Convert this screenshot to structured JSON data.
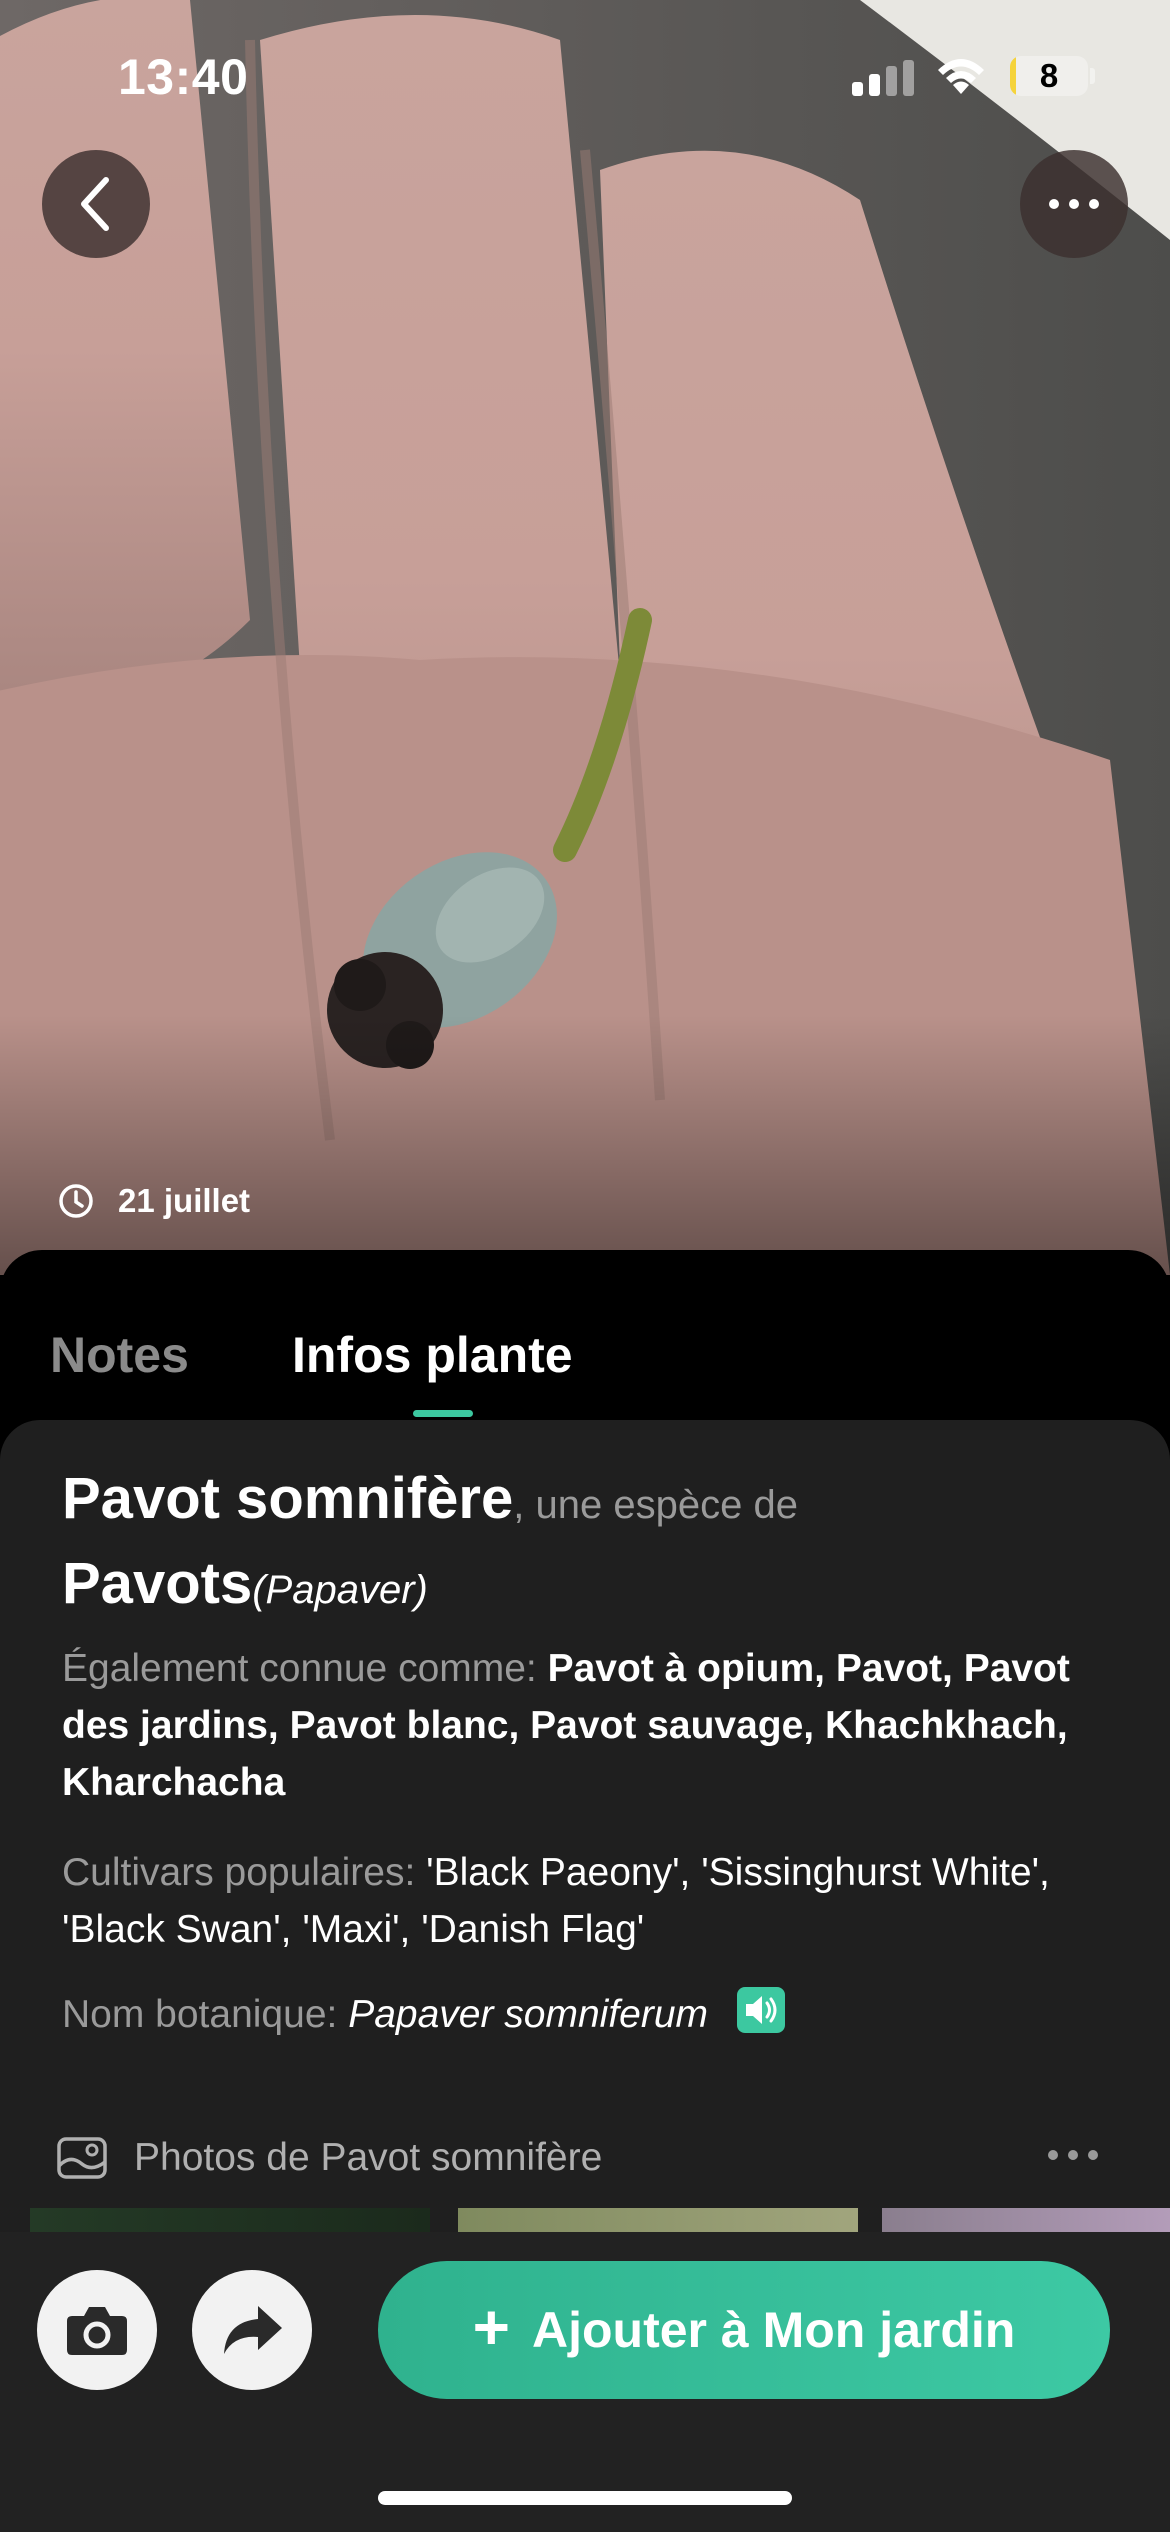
{
  "status_bar": {
    "time": "13:40",
    "battery_level": "8",
    "battery_fraction": 0.08
  },
  "photo": {
    "date": "21 juillet",
    "back_icon": "chevron-left-icon",
    "more_icon": "more-horizontal-icon",
    "clock_icon": "clock-icon"
  },
  "tabs": [
    {
      "label": "Notes",
      "active": false
    },
    {
      "label": "Infos plante",
      "active": true
    }
  ],
  "plant": {
    "common_name": "Pavot somnifère",
    "species_of": ", une espèce de",
    "genus": "Pavots",
    "genus_latin": "(Papaver)",
    "aka_label": "Également connue comme:",
    "aka_values": "Pavot à opium, Pavot, Pavot des jardins, Pavot blanc, Pavot sauvage, Khachkhach, Kharchacha",
    "cultivars_label": "Cultivars populaires:",
    "cultivars_values": "'Black Paeony', 'Sissinghurst White', 'Black Swan', 'Maxi', 'Danish Flag'",
    "botanical_label": "Nom botanique:",
    "botanical_value": "Papaver somniferum"
  },
  "photos_section": {
    "title": "Photos de Pavot somnifère",
    "icon": "photo-gallery-icon"
  },
  "bottom_bar": {
    "camera_icon": "camera-icon",
    "share_icon": "share-arrow-icon",
    "add_label": "Ajouter à Mon jardin"
  },
  "colors": {
    "accent": "#3cc8a0",
    "card_bg": "#1f1f1f",
    "bar_bg": "#222222"
  }
}
